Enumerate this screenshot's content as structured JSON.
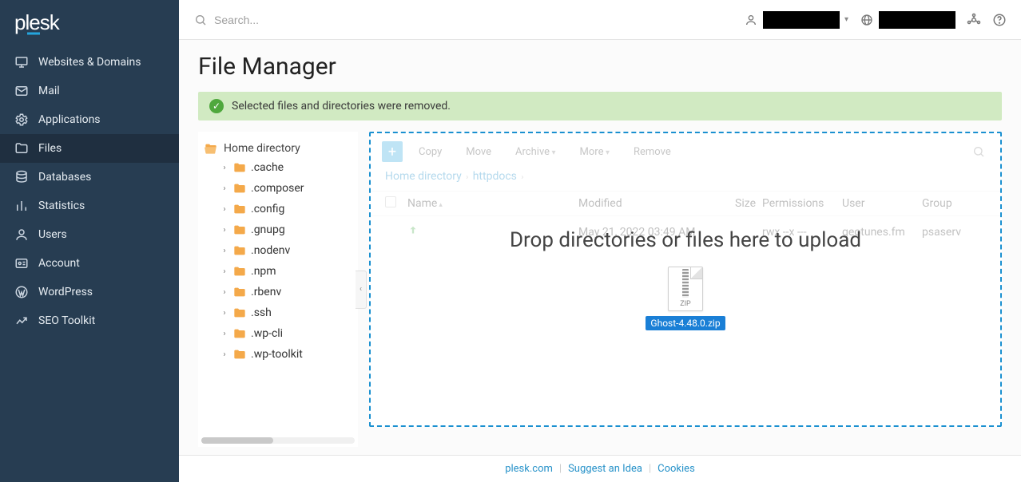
{
  "brand": "plesk",
  "search": {
    "placeholder": "Search..."
  },
  "sidebar": {
    "items": [
      {
        "label": "Websites & Domains",
        "icon": "monitor"
      },
      {
        "label": "Mail",
        "icon": "mail"
      },
      {
        "label": "Applications",
        "icon": "gear"
      },
      {
        "label": "Files",
        "icon": "folder",
        "active": true
      },
      {
        "label": "Databases",
        "icon": "database"
      },
      {
        "label": "Statistics",
        "icon": "bars"
      },
      {
        "label": "Users",
        "icon": "user"
      },
      {
        "label": "Account",
        "icon": "card"
      },
      {
        "label": "WordPress",
        "icon": "wp"
      },
      {
        "label": "SEO Toolkit",
        "icon": "chart"
      }
    ]
  },
  "page": {
    "title": "File Manager"
  },
  "alert": {
    "text": "Selected files and directories were removed."
  },
  "tree": {
    "root": "Home directory",
    "items": [
      {
        "label": ".cache"
      },
      {
        "label": ".composer"
      },
      {
        "label": ".config"
      },
      {
        "label": ".gnupg"
      },
      {
        "label": ".nodenv"
      },
      {
        "label": ".npm"
      },
      {
        "label": ".rbenv"
      },
      {
        "label": ".ssh"
      },
      {
        "label": ".wp-cli"
      },
      {
        "label": ".wp-toolkit"
      }
    ]
  },
  "toolbar": {
    "copy": "Copy",
    "move": "Move",
    "archive": "Archive",
    "more": "More",
    "remove": "Remove"
  },
  "breadcrumb": {
    "root": "Home directory",
    "current": "httpdocs"
  },
  "columns": {
    "name": "Name",
    "modified": "Modified",
    "size": "Size",
    "permissions": "Permissions",
    "user": "User",
    "group": "Group"
  },
  "row": {
    "name": "",
    "modified": "May 21, 2022 03:49 AM",
    "size": "",
    "permissions": "rwx --x ---",
    "user": "geotunes.fm",
    "group": "psaserv"
  },
  "dropzone": {
    "text": "Drop directories or files here to upload",
    "file_ext": "ZIP",
    "file_name": "Ghost-4.48.0.zip"
  },
  "footer": {
    "a": "plesk.com",
    "b": "Suggest an Idea",
    "c": "Cookies"
  }
}
